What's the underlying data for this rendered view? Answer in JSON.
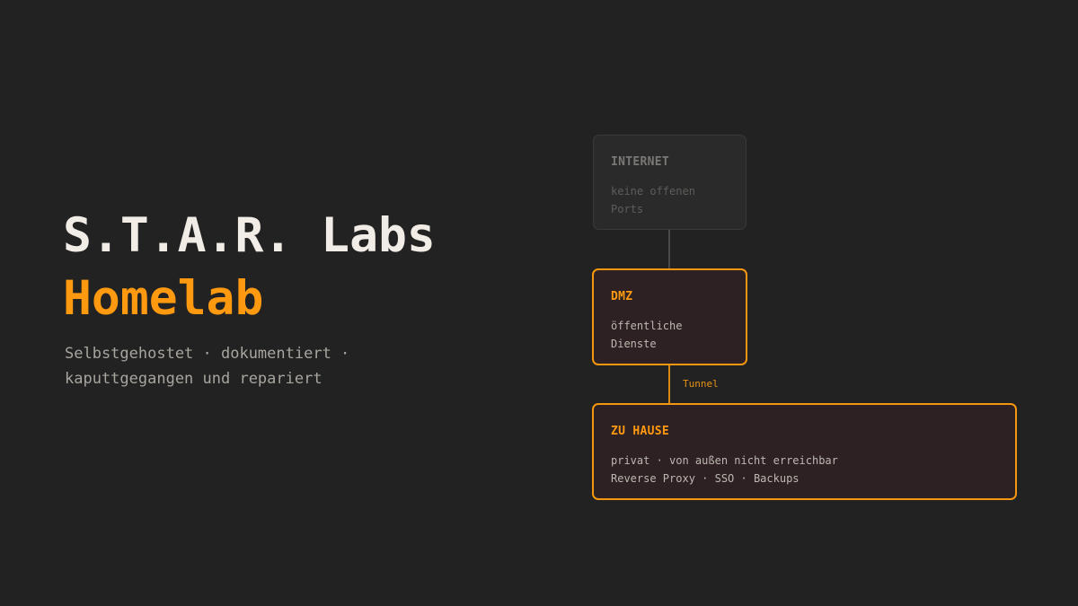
{
  "hero": {
    "title": "S.T.A.R. Labs",
    "subtitle": "Homelab",
    "tagline": "Selbstgehostet · dokumentiert · kaputtgegangen und repariert"
  },
  "diagram": {
    "internet": {
      "title": "INTERNET",
      "description": "keine offenen Ports"
    },
    "dmz": {
      "title": "DMZ",
      "description": "öffentliche Dienste"
    },
    "home": {
      "title": "ZU HAUSE",
      "line1": "privat · von außen nicht erreichbar",
      "line2": "Reverse Proxy · SSO · Backups"
    },
    "tunnel_label": "Tunnel"
  },
  "colors": {
    "accent": "#ff9a10",
    "background": "#222222",
    "title_text": "#f1ede6",
    "muted_text": "#a8a49e"
  }
}
